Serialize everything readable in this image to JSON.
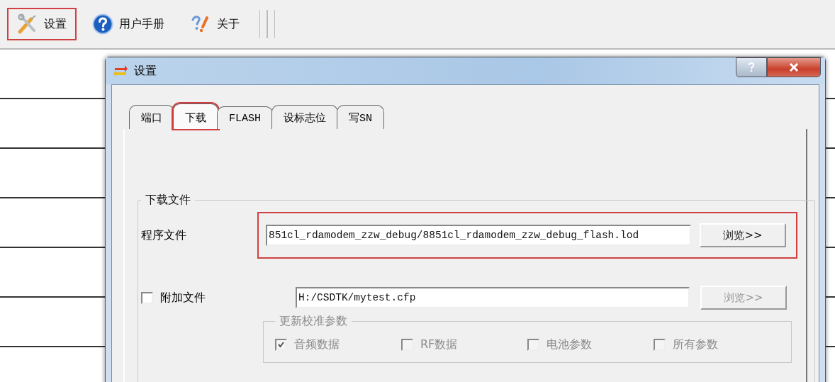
{
  "toolbar": [
    {
      "kind": "tools",
      "label": "设置",
      "highlighted": true
    },
    {
      "kind": "help",
      "label": "用户手册",
      "highlighted": false
    },
    {
      "kind": "about",
      "label": "关于",
      "highlighted": false
    }
  ],
  "dialog": {
    "title": "设置",
    "tabs": [
      {
        "label": "端口",
        "selected": false,
        "highlighted": false
      },
      {
        "label": "下载",
        "selected": true,
        "highlighted": true
      },
      {
        "label": "FLASH",
        "selected": false,
        "highlighted": false
      },
      {
        "label": "设标志位",
        "selected": false,
        "highlighted": false
      },
      {
        "label": "写SN",
        "selected": false,
        "highlighted": false
      }
    ],
    "group": {
      "title": "下载文件",
      "program": {
        "label": "程序文件",
        "value": "851cl_rdamodem_zzw_debug/8851cl_rdamodem_zzw_debug_flash.lod",
        "button": "浏览>>",
        "highlighted": true
      },
      "extra": {
        "label": "附加文件",
        "checked": false,
        "value": "H:/CSDTK/mytest.cfp",
        "button": "浏览>>",
        "button_disabled": true
      },
      "calib": {
        "title": "更新校准参数",
        "disabled": true,
        "options": [
          {
            "label": "音频数据",
            "checked": true
          },
          {
            "label": "RF数据",
            "checked": false
          },
          {
            "label": "电池参数",
            "checked": false
          },
          {
            "label": "所有参数",
            "checked": false
          }
        ]
      }
    }
  }
}
